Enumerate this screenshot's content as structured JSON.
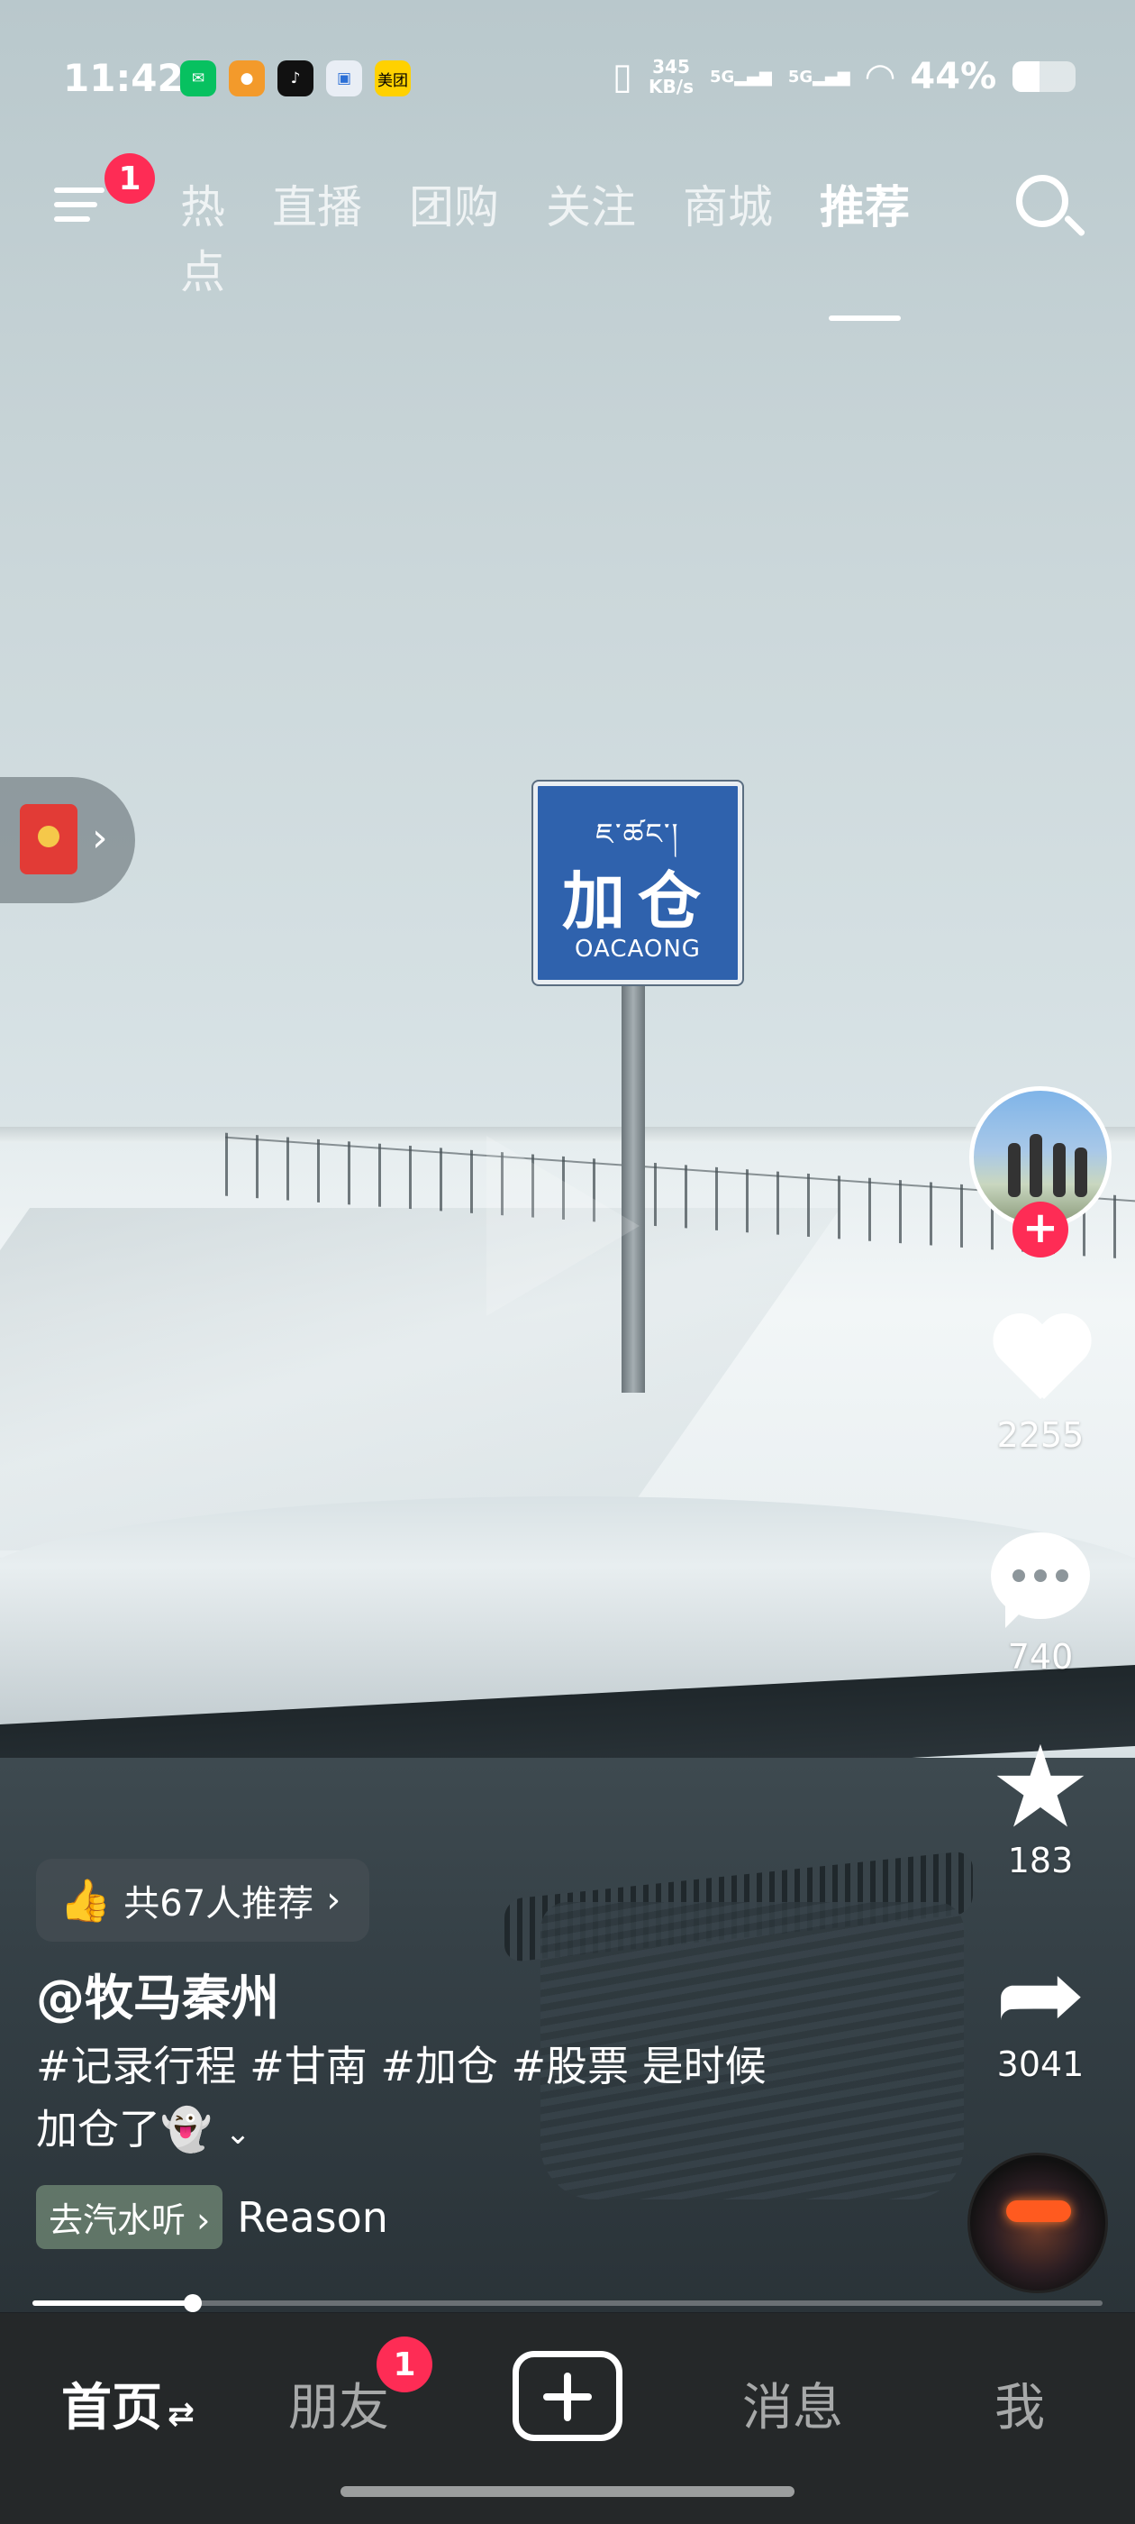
{
  "status_bar": {
    "time": "11:42",
    "app_icons": [
      "wechat-icon",
      "chat-icon",
      "tiktok-icon",
      "messages-icon",
      "meituan-icon"
    ],
    "meituan_label": "美团",
    "net_speed_value": "345",
    "net_speed_unit": "KB/s",
    "sim1": "5G",
    "sim2": "5G",
    "battery": "44%",
    "battery_level": 0.44
  },
  "top_nav": {
    "menu_badge": "1",
    "tabs": [
      "热点",
      "直播",
      "团购",
      "关注",
      "商城",
      "推荐"
    ],
    "active_tab": "推荐"
  },
  "video": {
    "sign_tibetan": "ཇ་ཚང་།",
    "sign_chinese": "加仓",
    "sign_pinyin": "OACAONG"
  },
  "side_actions": {
    "likes": "2255",
    "comments": "740",
    "favorites": "183",
    "shares": "3041"
  },
  "info": {
    "recommend_text": "共67人推荐",
    "author": "@牧马秦州",
    "description_line1": "#记录行程 #甘南 #加仓 #股票 是时候",
    "description_line2": "加仓了👻",
    "music_tag": "去汽水听",
    "music_name": "Reason"
  },
  "progress": {
    "played_fraction": 0.15
  },
  "tab_bar": {
    "home": "首页",
    "friends": "朋友",
    "friends_badge": "1",
    "messages": "消息",
    "me": "我"
  },
  "colors": {
    "accent": "#fe2c55",
    "tab_bar_bg": "#252829"
  }
}
